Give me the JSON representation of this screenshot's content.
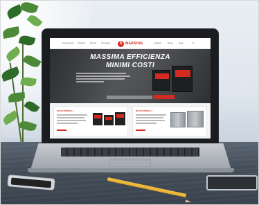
{
  "website": {
    "nav": {
      "left_items": [
        "Compressori",
        "Prodotti",
        "Servizi",
        "Chi siamo"
      ],
      "right_items": [
        "Contatti",
        "News",
        "Area",
        "IT"
      ]
    },
    "logo_mark": "S",
    "logo_text": "MARSHAL",
    "hero": {
      "title": "MASSIMA EFFICIENZA",
      "subtitle": "MINIMI COSTI"
    },
    "cards": [
      {
        "title": "NUOVI MODELLI"
      },
      {
        "title": "NUOVI MODELLI"
      }
    ]
  },
  "colors": {
    "brand_red": "#d42a1f",
    "desk": "#454f5a",
    "laptop_bezel": "#1a1c1f"
  }
}
